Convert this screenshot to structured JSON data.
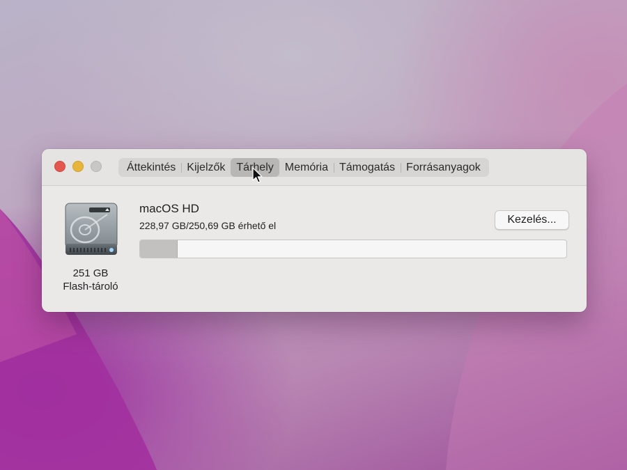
{
  "window": {
    "tabs": [
      {
        "label": "Áttekintés",
        "selected": false
      },
      {
        "label": "Kijelzők",
        "selected": false
      },
      {
        "label": "Tárhely",
        "selected": true
      },
      {
        "label": "Memória",
        "selected": false
      },
      {
        "label": "Támogatás",
        "selected": false
      },
      {
        "label": "Forrásanyagok",
        "selected": false
      }
    ],
    "disk": {
      "icon": "hard-drive-icon",
      "size_label": "251 GB",
      "type_label": "Flash-tároló"
    },
    "volume": {
      "name": "macOS HD",
      "free_text": "228,97 GB/250,69 GB érhető el",
      "used_fraction": 0.087
    },
    "manage_button_label": "Kezelés..."
  },
  "colors": {
    "close": "#e4574f",
    "minimize": "#e7b53b",
    "zoom_disabled": "#c9c7c6",
    "window_bg": "#ebe9e8"
  }
}
